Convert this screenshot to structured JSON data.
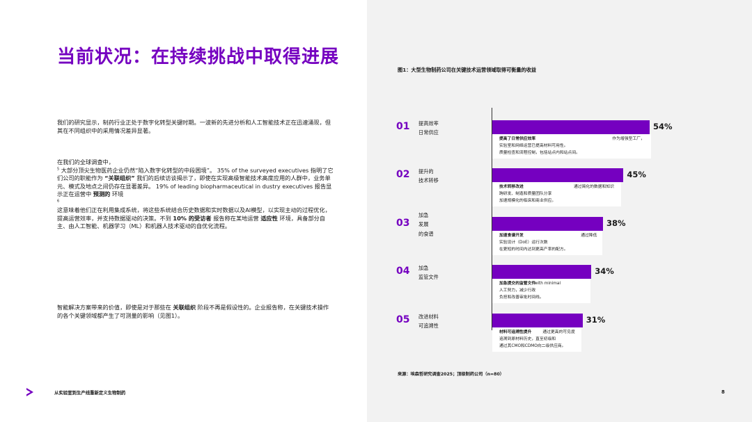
{
  "title": "当前状况：在持续挑战中取得进展",
  "intro": "我们的研究显示，制药行业正处于数字化转型关键时期。一波新的先进分析和人工智能技术正在迅速涌现，但其在不同组织中的采用情况差异显著。",
  "survey": {
    "line1": "在我们的全球调查中，",
    "fn1": "5",
    "seg_a": "大部分顶尖生物医药企业仍然“陷入数字化转型的中段困境”。 35% of the surveyed executives 指明了它们公司的职能作为",
    "bold_a": "“关联组织”",
    "seg_b": "我们的后续访谈揭示了，即使在实现高级智能技术高度应用的人群中，业务单元、模式及地点之间仍存在显著差异。 19% of leading biopharmaceutical in dustry executives 报告显示正在运营中",
    "bold_b": "预测的",
    "seg_c": "环境",
    "fn2": "6",
    "seg_d": "这意味着他们正在利用集成系统，将这些系统结合历史数据和实时数据以及AI模型，以实现主动的过程优化，提高运营效率，并支持数据驱动的决策。不到",
    "bold_c": "10% 的受访者",
    "seg_e": "报告称在某地运营",
    "bold_d": "适应性",
    "seg_f": "环境，具备部分自主、由人工智能、机器学习（ML）和机器人技术驱动的自优化流程。"
  },
  "value": {
    "seg_a": "智能解决方案带来的价值，即使是对于那些在",
    "bold_a": "关联组织",
    "seg_b": "阶段不再是假设性的。企业报告称，在关键技术操作的各个关键领域都产生了可测量的影响（见图1）。"
  },
  "footer": {
    "text": "从实验室到生产线重新定义生物制药",
    "page": "8"
  },
  "figure": {
    "title": "图1：大型生物制药公司在关键技术运营领域取得可衡量的收益",
    "source": "来源：埃森哲研究调查2025；顶级制药公司（n=80）"
  },
  "chart_data": {
    "type": "bar",
    "title": "图1：大型生物制药公司在关键技术运营领域取得可衡量的收益",
    "orientation": "horizontal",
    "categories": [
      "提高效率日常供应",
      "提升的技术转移",
      "加急发展的食谱",
      "加急监管文件",
      "改进材料可追溯性"
    ],
    "values": [
      54,
      45,
      38,
      34,
      31
    ],
    "unit": "%",
    "rows": [
      {
        "num": "01",
        "label": [
          "提高效率",
          "日常供应"
        ],
        "value": 54,
        "display": "54%",
        "desc": [
          {
            "bold": "提高了日常供应效率",
            "side": "作为增强型工厂，"
          },
          {
            "text": "实验室和网络运营已提高材料可用性。"
          },
          {
            "text": "质量检查和流程控制，包括站点内和站点间。"
          }
        ]
      },
      {
        "num": "02",
        "label": [
          "提升的",
          "技术转移"
        ],
        "value": 45,
        "display": "45%",
        "desc": [
          {
            "bold": "技术转移改进",
            "side": "通过简化的数据和知识"
          },
          {
            "text": "跨研发、制造和质量团队分享"
          },
          {
            "text": "加速规模化的临床和商业供应。"
          }
        ]
      },
      {
        "num": "03",
        "label": [
          "加急",
          "发展",
          "的食谱"
        ],
        "value": 38,
        "display": "38%",
        "desc": [
          {
            "bold": "加速食谱开发",
            "side": "通过降低"
          },
          {
            "text": "实验设计（DoE）运行次数"
          },
          {
            "text": "在更短的时间内达到更高产率的配方。"
          }
        ]
      },
      {
        "num": "04",
        "label": [
          "加急",
          "监管文件"
        ],
        "value": 34,
        "display": "34%",
        "desc": [
          {
            "bold": "加急提交的监管文件",
            "side": "with minimal"
          },
          {
            "text": "人工努力，减少行政"
          },
          {
            "text": "负担和改善审批时间线。"
          }
        ]
      },
      {
        "num": "05",
        "label": [
          "改进材料",
          "可追溯性"
        ],
        "value": 31,
        "display": "31%",
        "desc": [
          {
            "bold": "材料可追溯性提升",
            "side": "通过更高的可见度"
          },
          {
            "text": "追溯到原材料历史，直至初级和"
          },
          {
            "text": "通过其CMO和CDMO向二级供应商。"
          }
        ]
      }
    ]
  },
  "colors": {
    "accent": "#7500c0",
    "panel": "#f2f2f2"
  },
  "icons": {
    "logo": "chevron-right-logo-icon"
  }
}
